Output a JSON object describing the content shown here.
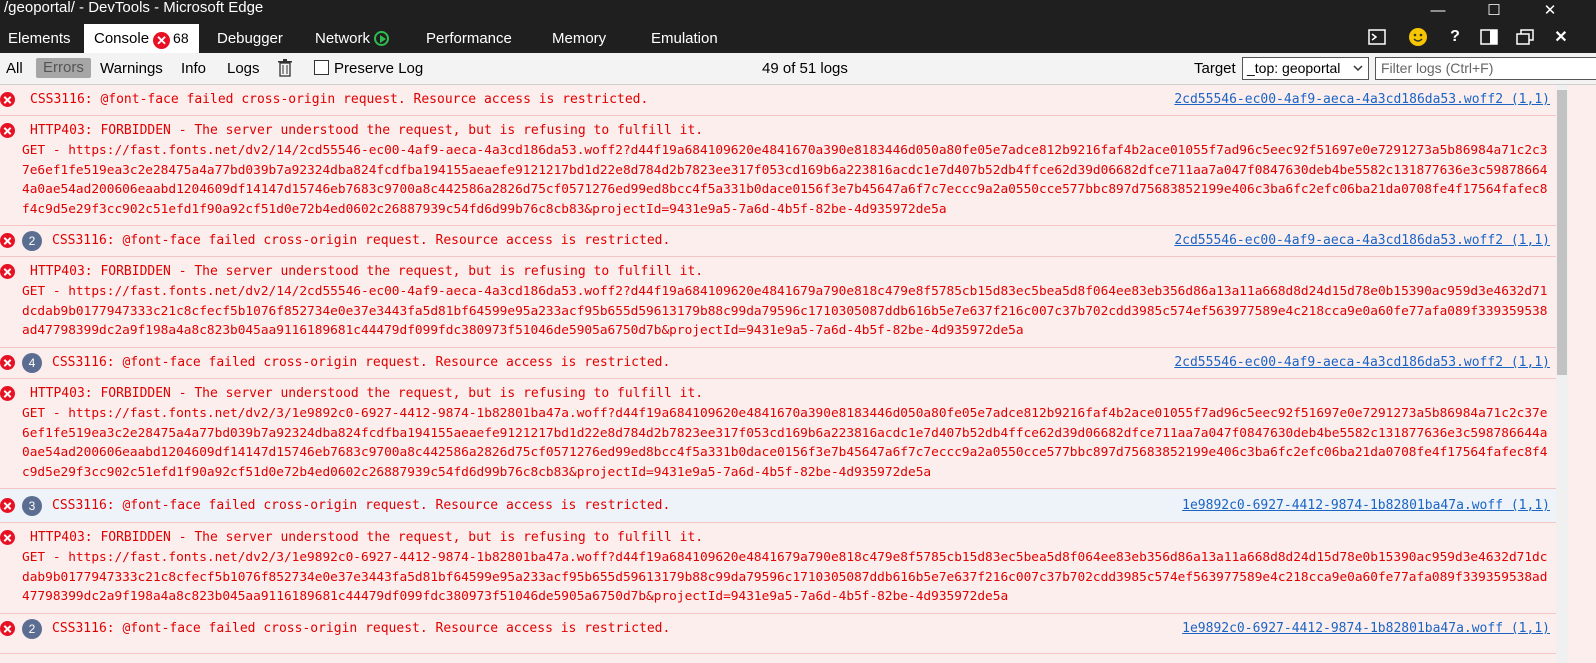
{
  "window": {
    "title": "/geoportal/ - DevTools - Microsoft Edge",
    "minimize_glyph": "—",
    "maximize_glyph": "☐",
    "close_glyph": "✕"
  },
  "tabs": {
    "elements": "Elements",
    "console": "Console",
    "console_error_glyph": "✕",
    "console_error_count": "68",
    "debugger": "Debugger",
    "network": "Network",
    "performance": "Performance",
    "memory": "Memory",
    "emulation": "Emulation"
  },
  "toolbar_icons": {
    "terminal": "terminal-icon",
    "smiley": "smiley-icon",
    "help": "?",
    "dock": "dock-icon",
    "undock": "undock-icon",
    "close": "✕"
  },
  "filters": {
    "all": "All",
    "errors": "Errors",
    "warnings": "Warnings",
    "info": "Info",
    "logs": "Logs",
    "preserve_log": "Preserve Log",
    "count": "49 of 51 logs",
    "target_label": "Target",
    "target_value": "_top: geoportal",
    "filter_placeholder": "Filter logs (Ctrl+F)"
  },
  "log": [
    {
      "repeat": null,
      "message": "CSS3116: @font-face failed cross-origin request. Resource access is restricted.",
      "source": "2cd55546-ec00-4af9-aeca-4a3cd186da53.woff2 (1,1)"
    },
    {
      "repeat": null,
      "message": "HTTP403: FORBIDDEN - The server understood the request, but is refusing to fulfill it.",
      "detail": "GET - https://fast.fonts.net/dv2/14/2cd55546-ec00-4af9-aeca-4a3cd186da53.woff2?d44f19a684109620e4841670a390e8183446d050a80fe05e7adce812b9216faf4b2ace01055f7ad96c5eec92f51697e0e7291273a5b86984a71c2c37e6ef1fe519ea3c2e28475a4a77bd039b7a92324dba824fcdfba194155aeaefe9121217bd1d22e8d784d2b7823ee317f053cd169b6a223816acdc1e7d407b52db4ffce62d39d06682dfce711aa7a047f0847630deb4be5582c131877636e3c598786644a0ae54ad200606eaabd1204609df14147d15746eb7683c9700a8c442586a2826d75cf0571276ed99ed8bcc4f5a331b0dace0156f3e7b45647a6f7c7eccc9a2a0550cce577bbc897d75683852199e406c3ba6fc2efc06ba21da0708fe4f17564fafec8f4c9d5e29f3cc902c51efd1f90a92cf51d0e72b4ed0602c26887939c54fd6d99b76c8cb83&projectId=9431e9a5-7a6d-4b5f-82be-4d935972de5a"
    },
    {
      "repeat": "2",
      "message": "CSS3116: @font-face failed cross-origin request. Resource access is restricted.",
      "source": "2cd55546-ec00-4af9-aeca-4a3cd186da53.woff2 (1,1)"
    },
    {
      "repeat": null,
      "message": "HTTP403: FORBIDDEN - The server understood the request, but is refusing to fulfill it.",
      "detail": "GET - https://fast.fonts.net/dv2/14/2cd55546-ec00-4af9-aeca-4a3cd186da53.woff2?d44f19a684109620e4841679a790e818c479e8f5785cb15d83ec5bea5d8f064ee83eb356d86a13a11a668d8d24d15d78e0b15390ac959d3e4632d71dcdab9b0177947333c21c8cfecf5b1076f852734e0e37e3443fa5d81bf64599e95a233acf95b655d59613179b88c99da79596c1710305087ddb616b5e7e637f216c007c37b702cdd3985c574ef563977589e4c218cca9e0a60fe77afa089f339359538ad47798399dc2a9f198a4a8c823b045aa9116189681c44479df099fdc380973f51046de5905a6750d7b&projectId=9431e9a5-7a6d-4b5f-82be-4d935972de5a"
    },
    {
      "repeat": "4",
      "message": "CSS3116: @font-face failed cross-origin request. Resource access is restricted.",
      "source": "2cd55546-ec00-4af9-aeca-4a3cd186da53.woff2 (1,1)"
    },
    {
      "repeat": null,
      "message": "HTTP403: FORBIDDEN - The server understood the request, but is refusing to fulfill it.",
      "detail": "GET - https://fast.fonts.net/dv2/3/1e9892c0-6927-4412-9874-1b82801ba47a.woff?d44f19a684109620e4841670a390e8183446d050a80fe05e7adce812b9216faf4b2ace01055f7ad96c5eec92f51697e0e7291273a5b86984a71c2c37e6ef1fe519ea3c2e28475a4a77bd039b7a92324dba824fcdfba194155aeaefe9121217bd1d22e8d784d2b7823ee317f053cd169b6a223816acdc1e7d407b52db4ffce62d39d06682dfce711aa7a047f0847630deb4be5582c131877636e3c598786644a0ae54ad200606eaabd1204609df14147d15746eb7683c9700a8c442586a2826d75cf0571276ed99ed8bcc4f5a331b0dace0156f3e7b45647a6f7c7eccc9a2a0550cce577bbc897d75683852199e406c3ba6fc2efc06ba21da0708fe4f17564fafec8f4c9d5e29f3cc902c51efd1f90a92cf51d0e72b4ed0602c26887939c54fd6d99b76c8cb83&projectId=9431e9a5-7a6d-4b5f-82be-4d935972de5a"
    },
    {
      "repeat": "3",
      "message": "CSS3116: @font-face failed cross-origin request. Resource access is restricted.",
      "source": "1e9892c0-6927-4412-9874-1b82801ba47a.woff (1,1)"
    },
    {
      "repeat": null,
      "message": "HTTP403: FORBIDDEN - The server understood the request, but is refusing to fulfill it.",
      "detail": "GET - https://fast.fonts.net/dv2/3/1e9892c0-6927-4412-9874-1b82801ba47a.woff?d44f19a684109620e4841679a790e818c479e8f5785cb15d83ec5bea5d8f064ee83eb356d86a13a11a668d8d24d15d78e0b15390ac959d3e4632d71dcdab9b0177947333c21c8cfecf5b1076f852734e0e37e3443fa5d81bf64599e95a233acf95b655d59613179b88c99da79596c1710305087ddb616b5e7e637f216c007c37b702cdd3985c574ef563977589e4c218cca9e0a60fe77afa089f339359538ad47798399dc2a9f198a4a8c823b045aa9116189681c44479df099fdc380973f51046de5905a6750d7b&projectId=9431e9a5-7a6d-4b5f-82be-4d935972de5a"
    },
    {
      "repeat": "2",
      "message": "CSS3116: @font-face failed cross-origin request. Resource access is restricted.",
      "source": "1e9892c0-6927-4412-9874-1b82801ba47a.woff (1,1)"
    }
  ]
}
